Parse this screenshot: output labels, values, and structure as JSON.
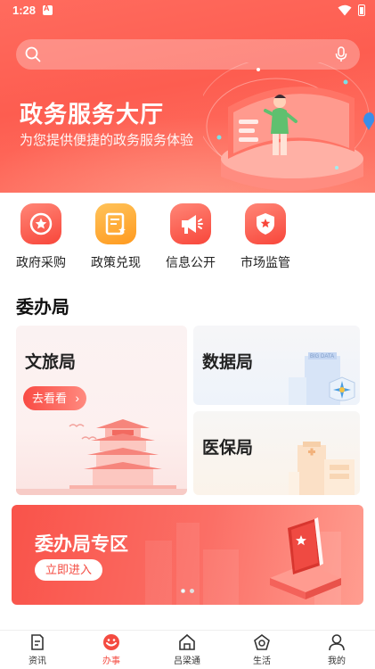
{
  "status_bar": {
    "time": "1:28"
  },
  "search": {
    "placeholder": ""
  },
  "hero": {
    "title": "政务服务大厅",
    "subtitle": "为您提供便捷的政务服务体验"
  },
  "quick_links": [
    {
      "label": "政府采购",
      "icon": "star-badge-icon"
    },
    {
      "label": "政策兑现",
      "icon": "document-star-icon"
    },
    {
      "label": "信息公开",
      "icon": "megaphone-icon"
    },
    {
      "label": "市场监管",
      "icon": "police-shield-icon"
    }
  ],
  "section": {
    "title": "委办局",
    "cards": [
      {
        "title": "文旅局",
        "button": "去看看"
      },
      {
        "title": "数据局",
        "illustration_text": "BIG DATA"
      },
      {
        "title": "医保局"
      }
    ]
  },
  "banner": {
    "title": "委办局专区",
    "button": "立即进入",
    "pages": 2,
    "active_page": 1
  },
  "tabbar": [
    {
      "label": "资讯",
      "icon": "news-icon"
    },
    {
      "label": "办事",
      "icon": "service-icon",
      "active": true
    },
    {
      "label": "吕梁通",
      "icon": "home-icon"
    },
    {
      "label": "生活",
      "icon": "life-icon"
    },
    {
      "label": "我的",
      "icon": "profile-icon"
    }
  ],
  "colors": {
    "primary": "#f44b41",
    "hero": "#fd5d50",
    "accent_orange": "#ff9a1f"
  }
}
